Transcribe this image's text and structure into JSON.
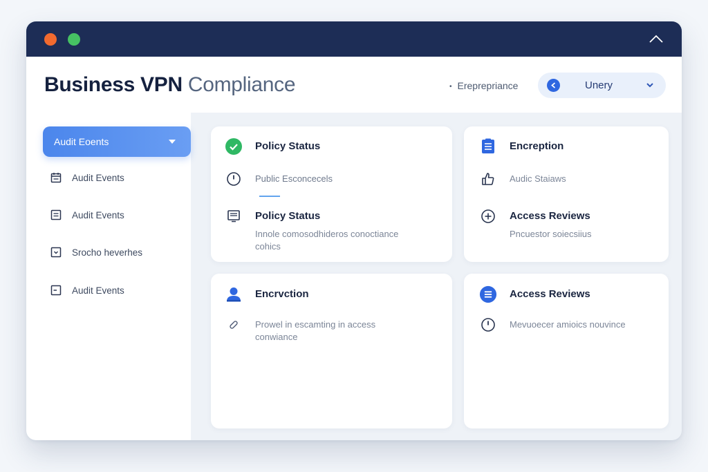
{
  "header": {
    "title_main": "Business VPN",
    "title_light": "Compliance",
    "env_label": "Ereprepriance",
    "select_value": "Unery"
  },
  "sidebar": {
    "active_label": "Audit Eoents",
    "items": [
      {
        "label": "Audit Events",
        "icon": "calendar-icon"
      },
      {
        "label": "Audit Events",
        "icon": "document-icon"
      },
      {
        "label": "Srocho heverhes",
        "icon": "download-box-icon"
      },
      {
        "label": "Audit Events",
        "icon": "minus-box-icon"
      }
    ]
  },
  "cards": {
    "policy": {
      "title1": "Policy Status",
      "row2": "Public Esconcecels",
      "title3": "Policy Status",
      "desc3": "Innole comosodhideros conoctiance cohics"
    },
    "encryption_top": {
      "title1": "Encreption",
      "row2": "Audic Staiaws",
      "title3": "Access Reviews",
      "desc3": "Pncuestor soiecsiius"
    },
    "encryption_bottom": {
      "title1": "Encrvction",
      "desc2": "Prowel in escamting in access conwiance"
    },
    "access_bottom": {
      "title1": "Access Reviews",
      "desc2": "Mevuoecer amioics nouvince"
    }
  },
  "colors": {
    "titlebar": "#1d2d56",
    "accent": "#4b86ec",
    "success": "#2fb864",
    "dot_orange": "#f26a2f",
    "dot_green": "#46c163"
  }
}
